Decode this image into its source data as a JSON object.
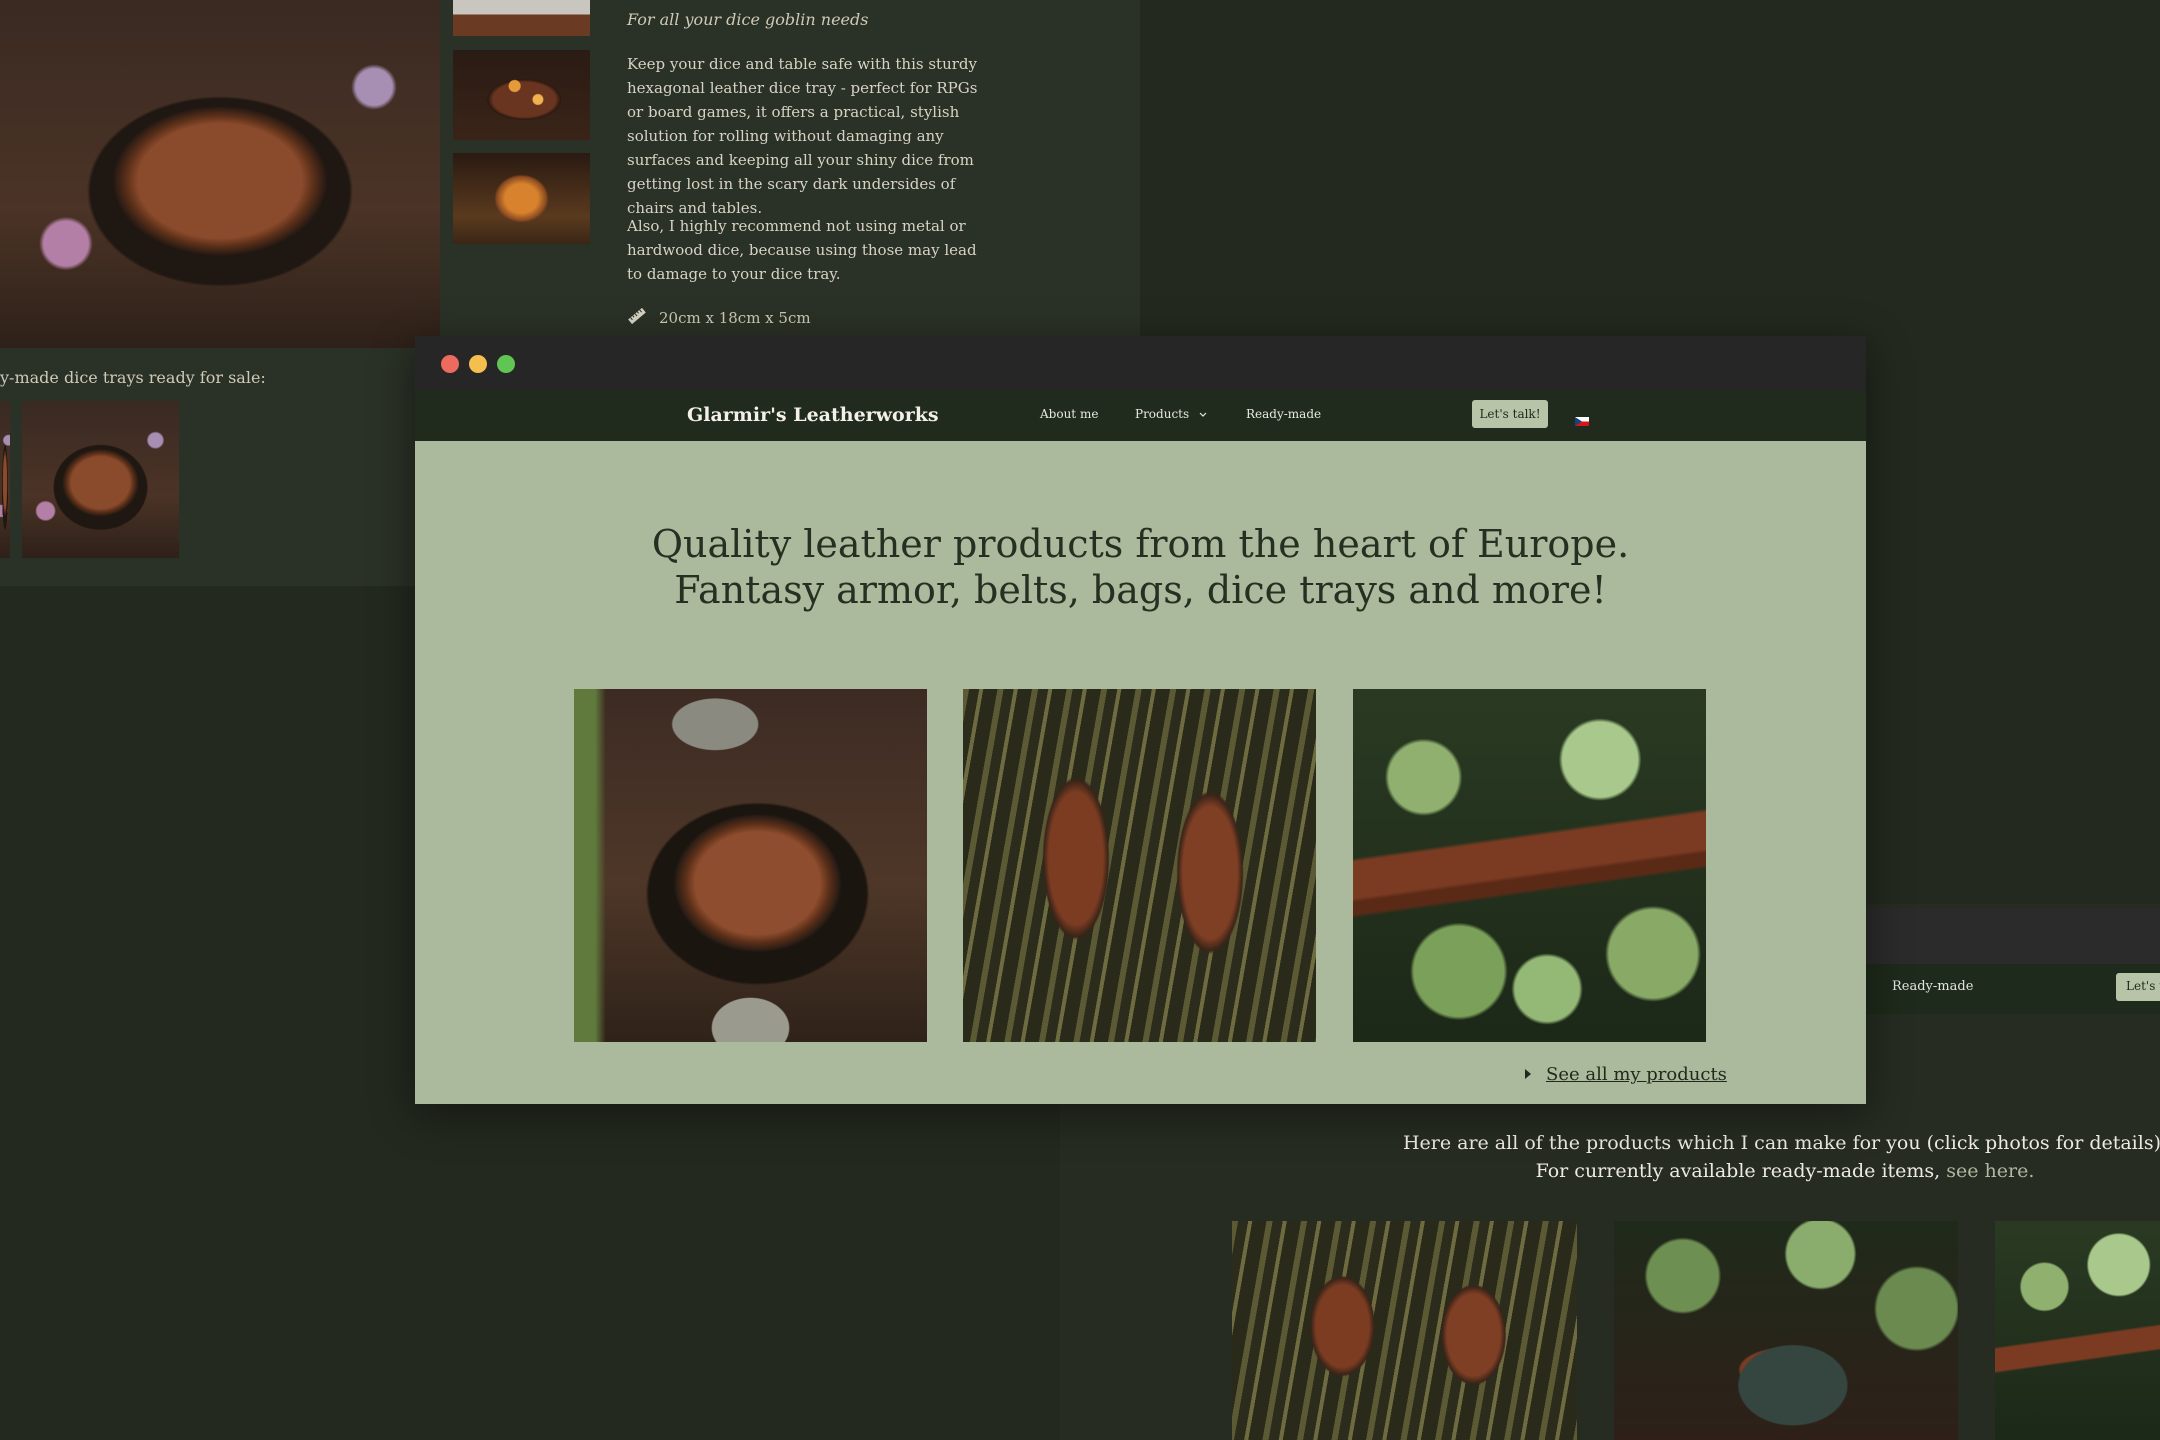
{
  "colors": {
    "background": "#23291f",
    "navbar": "#202a1d",
    "hero": "#abba9c",
    "button": "#b8c4a8",
    "dot_red": "#ec6a5e",
    "dot_yellow": "#f4bf4f",
    "dot_green": "#61c554"
  },
  "product_page": {
    "tagline": "For all your dice goblin needs",
    "paragraph1": "Keep your dice and table safe with this sturdy hexagonal leather dice tray - perfect for RPGs or board games, it offers a practical, stylish solution for rolling without damaging any surfaces and keeping all your shiny dice from getting lost in the scary dark undersides of chairs and tables.",
    "paragraph2": "Also, I highly recommend not using metal or hardwood dice, because using those may lead to damage to your dice tray.",
    "size": "20cm x 18cm x 5cm",
    "ready_made_heading": "y-made dice trays ready for sale:"
  },
  "window": {
    "brand": "Glarmir's Leatherworks",
    "nav": {
      "about": "About me",
      "products": "Products",
      "ready_made": "Ready-made"
    },
    "cta": "Let's talk!",
    "headline_line1": "Quality leather products from the heart of Europe.",
    "headline_line2": "Fantasy armor, belts, bags, dice trays and more!",
    "see_all": "See all my products",
    "language_icon": "czech-flag-icon"
  },
  "products_page": {
    "nav_ready_made": "Ready-made",
    "cta_partial": "Let's t",
    "intro_line1": "Here are all of the products which I can make for you (click photos for details).",
    "intro_line2_prefix": "For currently available ready-made items, ",
    "intro_link": "see here."
  }
}
